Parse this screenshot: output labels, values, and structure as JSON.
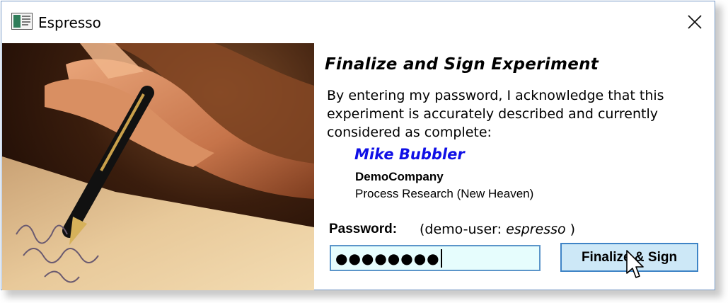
{
  "window": {
    "title": "Espresso",
    "app_icon": "espresso-app-icon",
    "close_icon": "close-icon"
  },
  "image": {
    "semantic": "hand-signing-with-fountain-pen-photo"
  },
  "content": {
    "heading": "Finalize and Sign Experiment",
    "acknowledgement": "By entering my password, I acknowledge that this experiment is accurately described and currently considered as complete:",
    "signer_name": "Mike Bubbler",
    "company": "DemoCompany",
    "department": "Process Research (New Heaven)"
  },
  "password": {
    "label": "Password:",
    "hint_prefix": "(demo-user: ",
    "hint_user": "espresso",
    "hint_suffix": " )",
    "masked_value": "●●●●●●●●"
  },
  "actions": {
    "finalize_label": "Finalize & Sign"
  },
  "colors": {
    "signer": "#1010e6",
    "input_bg": "#e6fdfd",
    "input_border": "#5b95c9",
    "button_bg": "#cde8f7",
    "button_border": "#3f84c6"
  }
}
